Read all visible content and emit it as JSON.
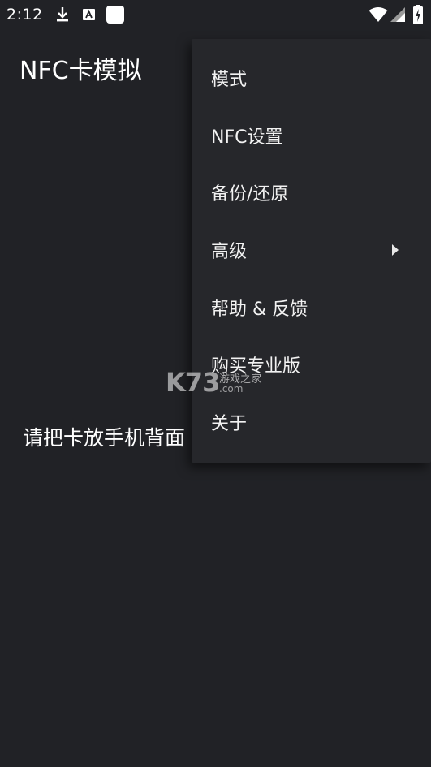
{
  "status_bar": {
    "time": "2:12",
    "icons": [
      "download-icon",
      "keyboard-icon",
      "notification-square-icon",
      "wifi-icon",
      "signal-icon",
      "battery-charging-icon"
    ]
  },
  "app": {
    "title": "NFC卡模拟"
  },
  "main": {
    "message": "请把卡放手机背面"
  },
  "menu": {
    "items": [
      {
        "label": "模式",
        "has_submenu": false
      },
      {
        "label": "NFC设置",
        "has_submenu": false
      },
      {
        "label": "备份/还原",
        "has_submenu": false
      },
      {
        "label": "高级",
        "has_submenu": true
      },
      {
        "label": "帮助 & 反馈",
        "has_submenu": false
      },
      {
        "label": "购买专业版",
        "has_submenu": false
      },
      {
        "label": "关于",
        "has_submenu": false
      }
    ]
  },
  "watermark": {
    "logo": "K73",
    "text_cn": "游戏之家",
    "text_domain": ".com"
  },
  "colors": {
    "background": "#212226",
    "menu_background": "#26272b",
    "text": "#ffffff"
  }
}
